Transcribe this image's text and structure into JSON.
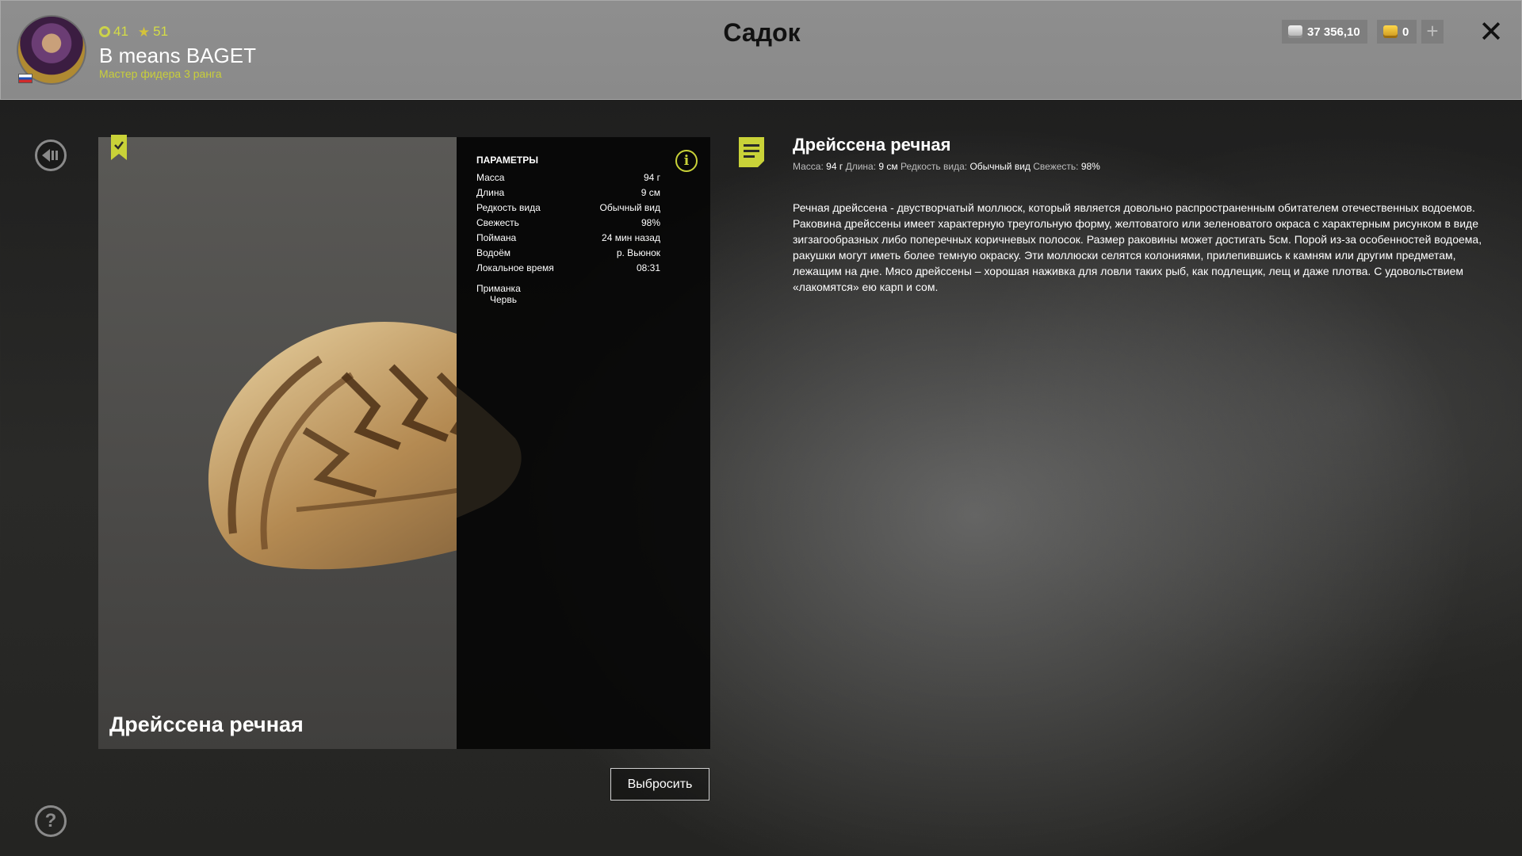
{
  "header": {
    "title": "Садок",
    "player": {
      "level": "41",
      "stars": "51",
      "name": "B means BAGET",
      "rank": "Мастер фидера 3 ранга"
    },
    "wallet": {
      "silver": "37 356,10",
      "gold": "0"
    },
    "plus_label": "+",
    "close_label": "✕"
  },
  "fish_card": {
    "name": "Дрейссена речная",
    "params_title": "ПАРАМЕТРЫ",
    "params": [
      {
        "label": "Масса",
        "value": "94 г"
      },
      {
        "label": "Длина",
        "value": "9 см"
      },
      {
        "label": "Редкость вида",
        "value": "Обычный вид"
      },
      {
        "label": "Свежесть",
        "value": "98%"
      },
      {
        "label": "Поймана",
        "value": "24 мин назад"
      },
      {
        "label": "Водоём",
        "value": "р. Вьюнок"
      },
      {
        "label": "Локальное время",
        "value": "08:31"
      }
    ],
    "bait_label": "Приманка",
    "bait_value": "Червь",
    "discard_label": "Выбросить"
  },
  "description": {
    "title": "Дрейссена речная",
    "meta": [
      {
        "label": "Масса:",
        "value": "94 г"
      },
      {
        "label": "Длина:",
        "value": "9 см"
      },
      {
        "label": "Редкость вида:",
        "value": "Обычный вид"
      },
      {
        "label": "Свежесть:",
        "value": "98%"
      }
    ],
    "text": "Речная дрейссена - двустворчатый моллюск, который является довольно распространенным обитателем отечественных водоемов. Раковина дрейссены имеет характерную треугольную форму, желтоватого или зеленоватого окраса с характерным рисунком в виде зигзагообразных либо поперечных коричневых полосок. Размер раковины может достигать 5см. Порой из-за особенностей водоема, ракушки могут иметь более темную окраску. Эти моллюски селятся колониями, прилепившись к камням или другим предметам, лежащим на дне. Мясо дрейссены – хорошая наживка для ловли таких рыб, как подлещик, лещ и даже плотва. С удовольствием «лакомятся» ею карп и сом."
  },
  "icons": {
    "help": "?",
    "info": "i"
  },
  "colors": {
    "accent": "#c9d238",
    "header_bg": "#8e8e8e",
    "panel_bg": "#060606"
  }
}
